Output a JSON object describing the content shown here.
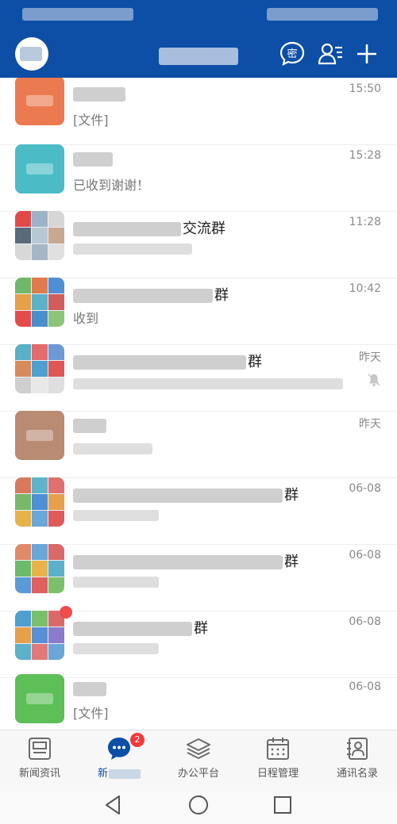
{
  "header": {
    "title": "",
    "secret_label": "密"
  },
  "conversations": [
    {
      "name_visible": "",
      "preview": "[文件]",
      "time": "15:50",
      "avatar_color": "#ec7a50"
    },
    {
      "name_visible": "",
      "preview": "已收到谢谢！",
      "time": "15:28",
      "avatar_color": "#4bbcc6"
    },
    {
      "name_visible": "交流群",
      "preview": "",
      "time": "11:28",
      "avatar_color": "grid"
    },
    {
      "name_visible": "群",
      "preview": "收到",
      "time": "10:42",
      "avatar_color": "grid"
    },
    {
      "name_visible": "群",
      "preview": "",
      "time": "昨天",
      "avatar_color": "grid",
      "muted": true
    },
    {
      "name_visible": "",
      "preview": "",
      "time": "昨天",
      "avatar_color": "#b88b72"
    },
    {
      "name_visible": "群",
      "preview": "",
      "time": "06-08",
      "avatar_color": "grid"
    },
    {
      "name_visible": "群",
      "preview": "",
      "time": "06-08",
      "avatar_color": "grid"
    },
    {
      "name_visible": "群",
      "preview": "",
      "time": "06-08",
      "avatar_color": "grid",
      "unread_dot": true
    },
    {
      "name_visible": "",
      "preview": "[文件]",
      "time": "06-08",
      "avatar_color": "#5cbf57"
    }
  ],
  "tabs": [
    {
      "label": "新闻资讯",
      "icon": "news-icon"
    },
    {
      "label": "新",
      "icon": "chat-bubble-icon",
      "badge": "2",
      "active": true
    },
    {
      "label": "办公平台",
      "icon": "layers-icon"
    },
    {
      "label": "日程管理",
      "icon": "calendar-icon"
    },
    {
      "label": "通讯名录",
      "icon": "contacts-icon"
    }
  ],
  "theme": {
    "primary": "#0d4ea6",
    "accent_red": "#f03b3b"
  }
}
